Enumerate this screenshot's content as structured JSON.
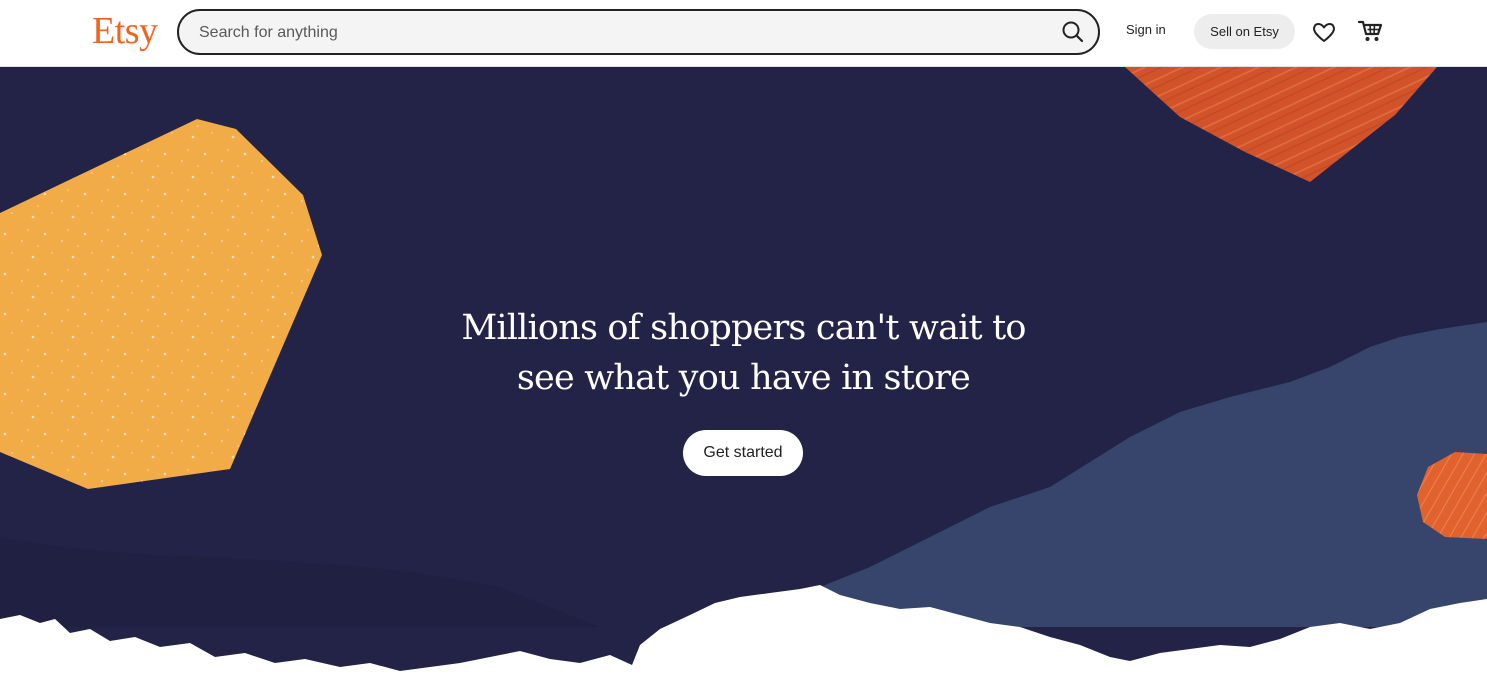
{
  "header": {
    "logo": "Etsy",
    "search": {
      "placeholder": "Search for anything",
      "value": ""
    },
    "sign_in_label": "Sign in",
    "sell_label": "Sell on Etsy",
    "icons": {
      "search": "search-icon",
      "favorites": "heart-icon",
      "cart": "cart-icon"
    }
  },
  "hero": {
    "headline_line1": "Millions of shoppers can't wait to",
    "headline_line2": "see what you have in store",
    "cta_label": "Get started"
  },
  "colors": {
    "brand": "#F1641E",
    "hero_background": "#232347",
    "accent_yellow": "#F2AC47",
    "accent_orange": "#DC5A2E",
    "accent_blue": "#37456D"
  }
}
